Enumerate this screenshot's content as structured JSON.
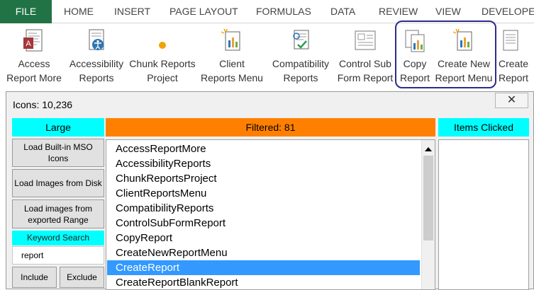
{
  "tabs": [
    {
      "name": "tab-file",
      "label": "FILE"
    },
    {
      "name": "tab-home",
      "label": "HOME"
    },
    {
      "name": "tab-insert",
      "label": "INSERT"
    },
    {
      "name": "tab-page-layout",
      "label": "PAGE LAYOUT"
    },
    {
      "name": "tab-formulas",
      "label": "FORMULAS"
    },
    {
      "name": "tab-data",
      "label": "DATA"
    },
    {
      "name": "tab-review",
      "label": "REVIEW"
    },
    {
      "name": "tab-view",
      "label": "VIEW"
    },
    {
      "name": "tab-developer",
      "label": "DEVELOPER"
    }
  ],
  "ribbon": {
    "buttons": [
      {
        "label1": "Access",
        "label2": "Report More",
        "icon": "access-report-more-icon"
      },
      {
        "label1": "Accessibility",
        "label2": "Reports",
        "icon": "accessibility-reports-icon"
      },
      {
        "label1": "Chunk Reports",
        "label2": "Project",
        "icon": "chunk-reports-project-icon"
      },
      {
        "label1": "Client",
        "label2": "Reports Menu",
        "icon": "client-reports-menu-icon"
      },
      {
        "label1": "Compatibility",
        "label2": "Reports",
        "icon": "compatibility-reports-icon"
      },
      {
        "label1": "Control Sub",
        "label2": "Form Report",
        "icon": "control-sub-form-report-icon"
      },
      {
        "label1": "Copy",
        "label2": "Report",
        "icon": "copy-report-icon"
      },
      {
        "label1": "Create New",
        "label2": "Report Menu",
        "icon": "create-new-report-menu-icon"
      },
      {
        "label1": "Create",
        "label2": "Report",
        "icon": "create-report-icon"
      }
    ]
  },
  "dialog": {
    "title": "Icons: 10,236",
    "close_glyph": "✕",
    "large_header": "Large",
    "filtered_header": "Filtered: 81",
    "clicked_header": "Items Clicked",
    "buttons": {
      "load_builtin": "Load Built-in MSO Icons",
      "load_disk": "Load Images from Disk",
      "load_range": "Load images from exported Range",
      "include": "Include",
      "exclude": "Exclude"
    },
    "keyword_label": "Keyword Search",
    "keyword_value": "report",
    "items": [
      "AccessReportMore",
      "AccessibilityReports",
      "ChunkReportsProject",
      "ClientReportsMenu",
      "CompatibilityReports",
      "ControlSubFormReport",
      "CopyReport",
      "CreateNewReportMenu",
      "CreateReport",
      "CreateReportBlankReport"
    ],
    "selected_index": 8
  },
  "colors": {
    "file_tab": "#217346",
    "cyan_header": "#00ffff",
    "orange_header": "#ff8000",
    "selection": "#3399ff",
    "highlight_border": "#2c2c8c"
  }
}
